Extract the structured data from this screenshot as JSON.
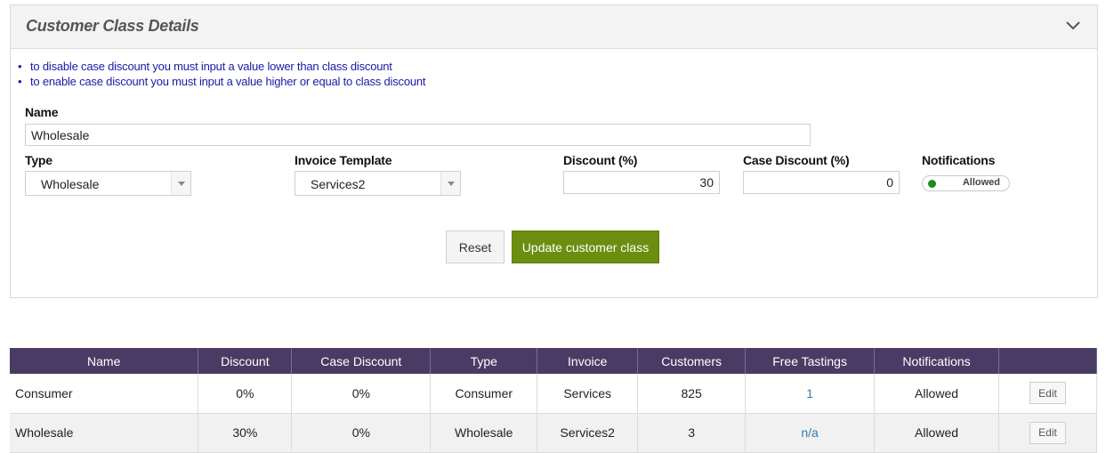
{
  "panel": {
    "title": "Customer Class Details",
    "notes": [
      "to disable case discount you must input a value lower than class discount",
      "to enable case discount you must input a value higher or equal to class discount"
    ]
  },
  "form": {
    "name": {
      "label": "Name",
      "value": "Wholesale"
    },
    "type": {
      "label": "Type",
      "value": "Wholesale"
    },
    "invoice_template": {
      "label": "Invoice Template",
      "value": "Services2"
    },
    "discount": {
      "label": "Discount (%)",
      "value": "30"
    },
    "case_discount": {
      "label": "Case Discount (%)",
      "value": "0"
    },
    "notifications": {
      "label": "Notifications",
      "value": "Allowed",
      "indicator_color": "#1e8a1e"
    },
    "buttons": {
      "reset": "Reset",
      "update": "Update customer class"
    }
  },
  "table": {
    "headers": [
      "Name",
      "Discount",
      "Case Discount",
      "Type",
      "Invoice",
      "Customers",
      "Free Tastings",
      "Notifications",
      ""
    ],
    "rows": [
      {
        "name": "Consumer",
        "discount": "0%",
        "case_discount": "0%",
        "type": "Consumer",
        "invoice": "Services",
        "customers": "825",
        "free_tastings": "1",
        "notifications": "Allowed",
        "action": "Edit"
      },
      {
        "name": "Wholesale",
        "discount": "30%",
        "case_discount": "0%",
        "type": "Wholesale",
        "invoice": "Services2",
        "customers": "3",
        "free_tastings": "n/a",
        "notifications": "Allowed",
        "action": "Edit"
      }
    ]
  },
  "colors": {
    "table_header": "#4a3b64",
    "primary_button": "#6b8e0f",
    "note_text": "#1a1aa6",
    "link": "#2f7fb6"
  },
  "icons": {
    "collapse": "chevron-down-icon",
    "dropdown": "dropdown-arrow-icon"
  }
}
